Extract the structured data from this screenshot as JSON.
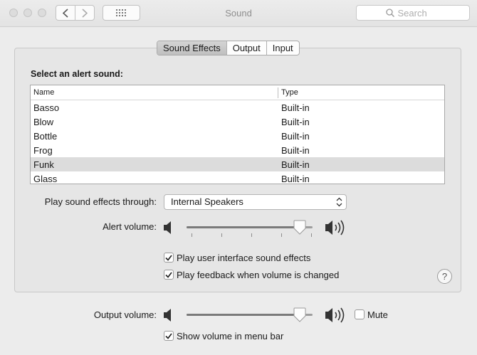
{
  "window": {
    "title": "Sound"
  },
  "search": {
    "placeholder": "Search"
  },
  "tabs": [
    {
      "label": "Sound Effects",
      "active": true
    },
    {
      "label": "Output",
      "active": false
    },
    {
      "label": "Input",
      "active": false
    }
  ],
  "sound_effects": {
    "section_label": "Select an alert sound:",
    "table": {
      "columns": [
        "Name",
        "Type"
      ],
      "rows": [
        {
          "name": "Basso",
          "type": "Built-in"
        },
        {
          "name": "Blow",
          "type": "Built-in"
        },
        {
          "name": "Bottle",
          "type": "Built-in"
        },
        {
          "name": "Frog",
          "type": "Built-in"
        },
        {
          "name": "Funk",
          "type": "Built-in",
          "selected": true
        },
        {
          "name": "Glass",
          "type": "Built-in"
        }
      ]
    },
    "play_through_label": "Play sound effects through:",
    "play_through_value": "Internal Speakers",
    "alert_volume_label": "Alert volume:",
    "alert_volume_level": 0.9,
    "ui_sounds": {
      "label": "Play user interface sound effects",
      "checked": true
    },
    "feedback": {
      "label": "Play feedback when volume is changed",
      "checked": true
    }
  },
  "output_volume": {
    "label": "Output volume:",
    "level": 0.9
  },
  "mute": {
    "label": "Mute",
    "checked": false
  },
  "menu_bar": {
    "label": "Show volume in menu bar",
    "checked": true
  },
  "help": {
    "glyph": "?"
  },
  "colors": {
    "selected_row": "#dcdcdc",
    "active_tab": "#c8c8c8"
  }
}
